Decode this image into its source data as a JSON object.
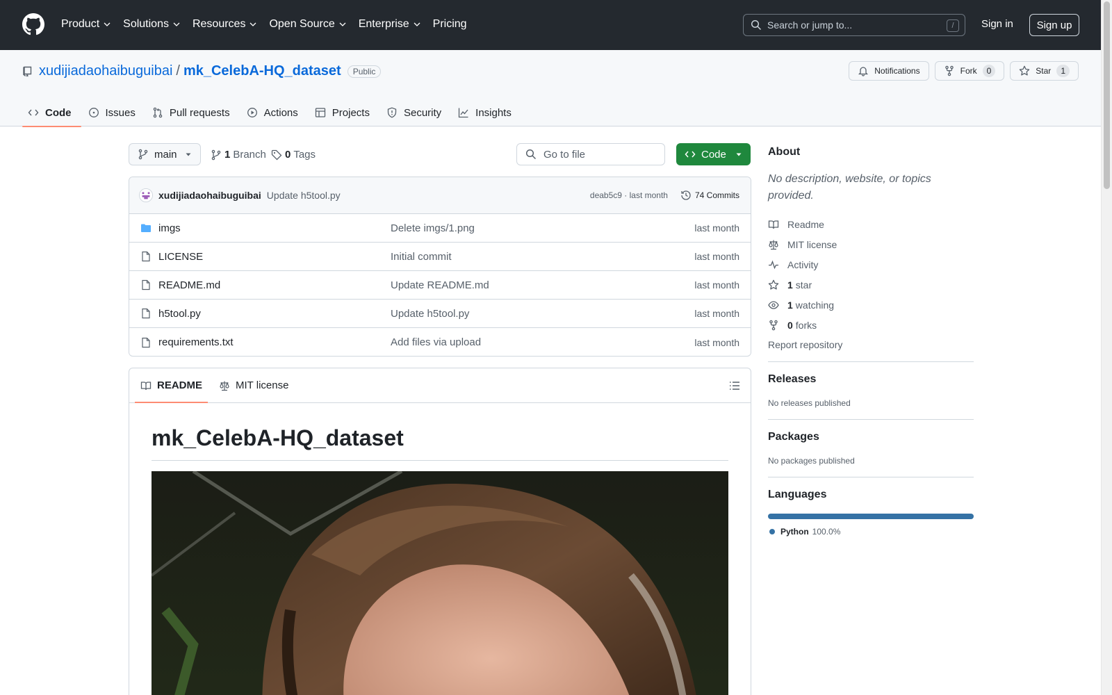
{
  "header": {
    "nav": [
      {
        "label": "Product",
        "has_caret": true
      },
      {
        "label": "Solutions",
        "has_caret": true
      },
      {
        "label": "Resources",
        "has_caret": true
      },
      {
        "label": "Open Source",
        "has_caret": true
      },
      {
        "label": "Enterprise",
        "has_caret": true
      },
      {
        "label": "Pricing",
        "has_caret": false
      }
    ],
    "search_placeholder": "Search or jump to...",
    "search_shortcut": "/",
    "sign_in": "Sign in",
    "sign_up": "Sign up"
  },
  "repo": {
    "owner": "xudijiadaohaibuguibai",
    "separator": "/",
    "name": "mk_CelebA-HQ_dataset",
    "visibility": "Public",
    "actions": {
      "notifications": "Notifications",
      "fork_label": "Fork",
      "fork_count": "0",
      "star_label": "Star",
      "star_count": "1"
    },
    "tabs": [
      {
        "label": "Code",
        "icon": "code-icon",
        "active": true
      },
      {
        "label": "Issues",
        "icon": "issue-icon",
        "active": false
      },
      {
        "label": "Pull requests",
        "icon": "pull-request-icon",
        "active": false
      },
      {
        "label": "Actions",
        "icon": "play-icon",
        "active": false
      },
      {
        "label": "Projects",
        "icon": "table-icon",
        "active": false
      },
      {
        "label": "Security",
        "icon": "shield-icon",
        "active": false
      },
      {
        "label": "Insights",
        "icon": "graph-icon",
        "active": false
      }
    ]
  },
  "toolbar": {
    "branch": "main",
    "branch_count": "1",
    "branch_label": "Branch",
    "tag_count": "0",
    "tag_label": "Tags",
    "goto_placeholder": "Go to file",
    "code_label": "Code"
  },
  "latest_commit": {
    "author": "xudijiadaohaibuguibai",
    "message": "Update h5tool.py",
    "hash_time": "deab5c9 · last month",
    "commits": "74 Commits"
  },
  "files": [
    {
      "name": "imgs",
      "type": "folder",
      "message": "Delete imgs/1.png",
      "date": "last month"
    },
    {
      "name": "LICENSE",
      "type": "file",
      "message": "Initial commit",
      "date": "last month"
    },
    {
      "name": "README.md",
      "type": "file",
      "message": "Update README.md",
      "date": "last month"
    },
    {
      "name": "h5tool.py",
      "type": "file",
      "message": "Update h5tool.py",
      "date": "last month"
    },
    {
      "name": "requirements.txt",
      "type": "file",
      "message": "Add files via upload",
      "date": "last month"
    }
  ],
  "readme": {
    "tabs": [
      "README",
      "MIT license"
    ],
    "title": "mk_CelebA-HQ_dataset"
  },
  "sidebar": {
    "about_title": "About",
    "about_desc": "No description, website, or topics provided.",
    "links": [
      {
        "icon": "book-icon",
        "count": "",
        "label": "Readme"
      },
      {
        "icon": "law-icon",
        "count": "",
        "label": "MIT license"
      },
      {
        "icon": "pulse-icon",
        "count": "",
        "label": "Activity"
      },
      {
        "icon": "star-icon",
        "count": "1",
        "label": "star"
      },
      {
        "icon": "eye-icon",
        "count": "1",
        "label": "watching"
      },
      {
        "icon": "fork-icon",
        "count": "0",
        "label": "forks"
      }
    ],
    "report": "Report repository",
    "releases_title": "Releases",
    "releases_text": "No releases published",
    "packages_title": "Packages",
    "packages_text": "No packages published",
    "languages_title": "Languages",
    "languages": [
      {
        "name": "Python",
        "percent": "100.0%",
        "color": "#3572a5"
      }
    ]
  },
  "colors": {
    "header_bg": "#24292f",
    "link": "#0969da",
    "code_button": "#1f883d",
    "active_tab_underline": "#fd8c73"
  }
}
